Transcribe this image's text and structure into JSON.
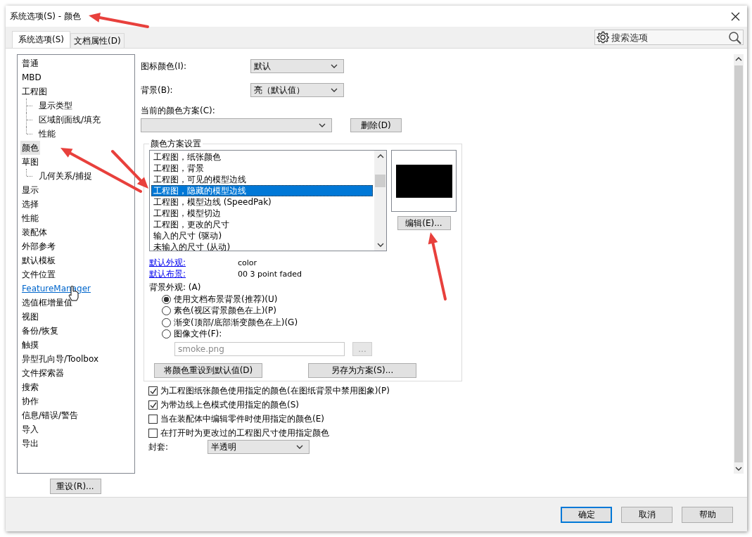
{
  "window": {
    "title": "系统选项(S) - 颜色"
  },
  "tabs": [
    {
      "label": "系统选项(S)",
      "selected": true
    },
    {
      "label": "文档属性(D)",
      "selected": false
    }
  ],
  "search": {
    "placeholder": "搜索选项"
  },
  "sidebar": {
    "items": [
      {
        "label": "普通",
        "selected": false,
        "hovered": false
      },
      {
        "label": "MBD",
        "selected": false,
        "hovered": false
      },
      {
        "label": "工程图",
        "selected": false,
        "hovered": false,
        "children": [
          {
            "label": "显示类型",
            "selected": false,
            "hovered": false
          },
          {
            "label": "区域剖面线/填充",
            "selected": false,
            "hovered": false
          },
          {
            "label": "性能",
            "selected": false,
            "hovered": false
          }
        ]
      },
      {
        "label": "颜色",
        "selected": true,
        "hovered": false
      },
      {
        "label": "草图",
        "selected": false,
        "hovered": false,
        "children": [
          {
            "label": "几何关系/捕捉",
            "selected": false,
            "hovered": false
          }
        ]
      },
      {
        "label": "显示",
        "selected": false,
        "hovered": false
      },
      {
        "label": "选择",
        "selected": false,
        "hovered": false
      },
      {
        "label": "性能",
        "selected": false,
        "hovered": false
      },
      {
        "label": "装配体",
        "selected": false,
        "hovered": false
      },
      {
        "label": "外部参考",
        "selected": false,
        "hovered": false
      },
      {
        "label": "默认模板",
        "selected": false,
        "hovered": false
      },
      {
        "label": "文件位置",
        "selected": false,
        "hovered": false
      },
      {
        "label": "FeatureManager",
        "selected": false,
        "hovered": true
      },
      {
        "label": "选值框增量值",
        "selected": false,
        "hovered": false
      },
      {
        "label": "视图",
        "selected": false,
        "hovered": false
      },
      {
        "label": "备份/恢复",
        "selected": false,
        "hovered": false
      },
      {
        "label": "触摸",
        "selected": false,
        "hovered": false
      },
      {
        "label": "异型孔向导/Toolbox",
        "selected": false,
        "hovered": false
      },
      {
        "label": "文件探索器",
        "selected": false,
        "hovered": false
      },
      {
        "label": "搜索",
        "selected": false,
        "hovered": false
      },
      {
        "label": "协作",
        "selected": false,
        "hovered": false
      },
      {
        "label": "信息/错误/警告",
        "selected": false,
        "hovered": false
      },
      {
        "label": "导入",
        "selected": false,
        "hovered": false
      },
      {
        "label": "导出",
        "selected": false,
        "hovered": false
      }
    ],
    "reset_button": "重设(R)..."
  },
  "icon_color": {
    "label": "图标颜色(I):",
    "value": "默认"
  },
  "background": {
    "label": "背景(B):",
    "value": "亮（默认值）"
  },
  "current_scheme": {
    "label": "当前的颜色方案(C):",
    "delete_button": "删除(D)"
  },
  "scheme_settings": {
    "title": "颜色方案设置",
    "items": [
      {
        "label": "工程图，纸张颜色",
        "selected": false
      },
      {
        "label": "工程图，背景",
        "selected": false
      },
      {
        "label": "工程图，可见的模型边线",
        "selected": false
      },
      {
        "label": "工程图，隐藏的模型边线",
        "selected": true
      },
      {
        "label": "工程图，模型边线 (SpeedPak)",
        "selected": false
      },
      {
        "label": "工程图，模型切边",
        "selected": false
      },
      {
        "label": "工程图，更改的尺寸",
        "selected": false
      },
      {
        "label": "输入的尺寸 (驱动)",
        "selected": false
      },
      {
        "label": "未输入的尺寸 (从动)",
        "selected": false
      }
    ],
    "edit_button": "编辑(E)...",
    "appearance": [
      {
        "label": "默认外观:",
        "value": "color"
      },
      {
        "label": "默认布景:",
        "value": "00 3 point faded"
      }
    ],
    "background_appearance": {
      "label": "背景外观: (A)",
      "options": [
        {
          "label": "使用文档布景背景(推荐)(U)",
          "selected": true
        },
        {
          "label": "素色(视区背景颜色在上)(P)",
          "selected": false
        },
        {
          "label": "渐变(顶部/底部渐变颜色在上)(G)",
          "selected": false
        },
        {
          "label": "图像文件(F):",
          "selected": false
        }
      ],
      "file": {
        "value": "smoke.png",
        "disabled": true
      },
      "browse_button": {
        "label": "...",
        "disabled": true
      }
    },
    "reset_colors_button": "将颜色重设到默认值(D)",
    "save_scheme_button": "另存为方案(S)..."
  },
  "checkboxes": [
    {
      "label": "为工程图纸张颜色使用指定的颜色(在图纸背景中禁用图象)(P)",
      "checked": true
    },
    {
      "label": "为带边线上色模式使用指定的颜色(S)",
      "checked": true
    },
    {
      "label": "当在装配体中编辑零件时使用指定的颜色(E)",
      "checked": false
    },
    {
      "label": "在打开时为更改过的工程图尺寸使用指定颜色",
      "checked": false
    }
  ],
  "envelope": {
    "label": "封套:",
    "value": "半透明"
  },
  "buttons": [
    {
      "label": "确定",
      "default": true
    },
    {
      "label": "取消",
      "default": false
    },
    {
      "label": "帮助",
      "default": false
    }
  ]
}
